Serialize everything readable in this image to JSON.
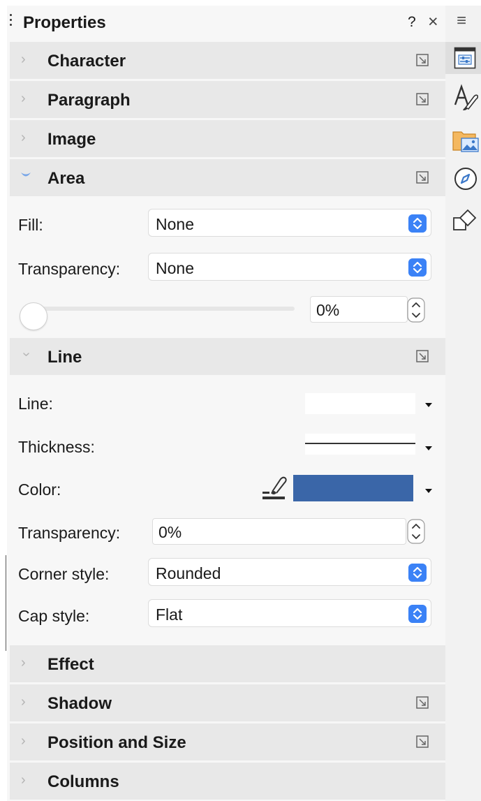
{
  "panel": {
    "title": "Properties",
    "help_label": "?",
    "close_label": "×",
    "menu_label": "≡"
  },
  "decks": {
    "character": "Character",
    "paragraph": "Paragraph",
    "image": "Image",
    "area": "Area",
    "line": "Line",
    "effect": "Effect",
    "shadow": "Shadow",
    "position": "Position and Size",
    "columns": "Columns"
  },
  "area": {
    "fill_label": "Fill:",
    "fill_value": "None",
    "transparency_label": "Transparency:",
    "transparency_value": "None",
    "transparency_percent": "0%",
    "slider_fraction": 0
  },
  "line": {
    "line_label": "Line:",
    "thickness_label": "Thickness:",
    "color_label": "Color:",
    "color_value": "#3a66a8",
    "transparency_label": "Transparency:",
    "transparency_value": "0%",
    "corner_label": "Corner style:",
    "corner_value": "Rounded",
    "cap_label": "Cap style:",
    "cap_value": "Flat"
  },
  "sidebar_tabs": [
    "properties-icon",
    "styles-icon",
    "gallery-icon",
    "navigator-icon",
    "shapes-icon"
  ],
  "colors": {
    "accent": "#3b82f6",
    "deck_bg": "#e8e8e8",
    "chevron_open": "#7aa7e8"
  }
}
